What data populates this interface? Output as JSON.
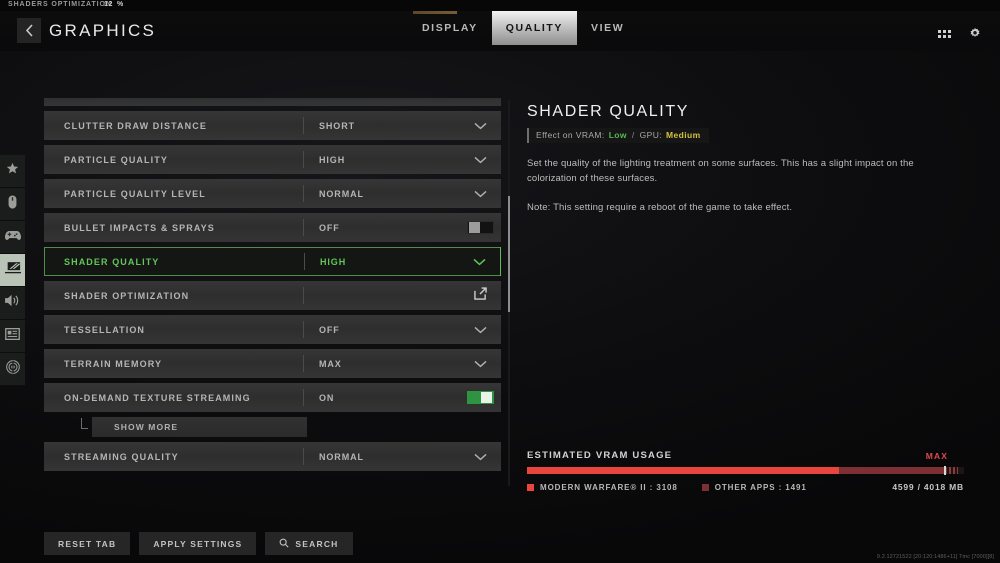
{
  "status_bar": {
    "label": "SHADERS OPTIMIZATION",
    "value": "12",
    "unit": "%"
  },
  "header": {
    "back_icon": "chevron-left-icon",
    "title": "GRAPHICS",
    "tabs": [
      {
        "label": "DISPLAY",
        "active": false
      },
      {
        "label": "QUALITY",
        "active": true
      },
      {
        "label": "VIEW",
        "active": false
      }
    ],
    "icons": [
      {
        "name": "grid-apps-icon"
      },
      {
        "name": "gear-icon"
      }
    ]
  },
  "sidebar": {
    "items": [
      {
        "name": "favorites",
        "icon": "star-icon",
        "active": false
      },
      {
        "name": "mouse-keyboard",
        "icon": "mouse-icon",
        "active": false
      },
      {
        "name": "controller",
        "icon": "gamepad-icon",
        "active": false
      },
      {
        "name": "graphics",
        "icon": "monitor-icon",
        "active": true
      },
      {
        "name": "audio",
        "icon": "speaker-icon",
        "active": false
      },
      {
        "name": "interface",
        "icon": "interface-icon",
        "active": false
      },
      {
        "name": "accessibility",
        "icon": "accessibility-icon",
        "active": false
      }
    ]
  },
  "settings": {
    "rows": [
      {
        "label": "CLUTTER DRAW DISTANCE",
        "value": "SHORT",
        "control": "dropdown",
        "selected": false
      },
      {
        "label": "PARTICLE QUALITY",
        "value": "HIGH",
        "control": "dropdown",
        "selected": false
      },
      {
        "label": "PARTICLE QUALITY LEVEL",
        "value": "NORMAL",
        "control": "dropdown",
        "selected": false
      },
      {
        "label": "BULLET IMPACTS & SPRAYS",
        "value": "OFF",
        "control": "toggle-off",
        "selected": false
      },
      {
        "label": "SHADER QUALITY",
        "value": "HIGH",
        "control": "dropdown",
        "selected": true
      },
      {
        "label": "SHADER OPTIMIZATION",
        "value": "",
        "control": "external-link",
        "selected": false
      },
      {
        "label": "TESSELLATION",
        "value": "OFF",
        "control": "dropdown",
        "selected": false
      },
      {
        "label": "TERRAIN MEMORY",
        "value": "MAX",
        "control": "dropdown",
        "selected": false
      },
      {
        "label": "ON-DEMAND TEXTURE STREAMING",
        "value": "ON",
        "control": "toggle-on",
        "selected": false
      }
    ],
    "show_more_label": "SHOW MORE",
    "last_row": {
      "label": "STREAMING QUALITY",
      "value": "NORMAL",
      "control": "dropdown",
      "selected": false
    }
  },
  "buttons": [
    {
      "label": "RESET TAB",
      "icon": null
    },
    {
      "label": "APPLY SETTINGS",
      "icon": null
    },
    {
      "label": "SEARCH",
      "icon": "search-icon"
    }
  ],
  "detail": {
    "title": "SHADER QUALITY",
    "effect_prefix": "Effect on VRAM:",
    "effect_vram": "Low",
    "effect_separator": "/",
    "effect_gpu_prefix": "GPU:",
    "effect_gpu": "Medium",
    "body": "Set the quality of the lighting treatment on some surfaces. This has a slight impact on the colorization of these surfaces.",
    "note": "Note: This setting require a reboot of the game to take effect."
  },
  "vram": {
    "title": "ESTIMATED VRAM USAGE",
    "max_label": "MAX",
    "legend": [
      {
        "label": "MODERN WARFARE® II : 3108",
        "color": "#e8453f"
      },
      {
        "label": "OTHER APPS : 1491",
        "color": "#7d3033"
      }
    ],
    "total": "4599 / 4018 MB",
    "bar": {
      "game_pct": 71.3,
      "other_pct": 24.9,
      "max_marker_pct": 95.5
    }
  },
  "build_text": "9.2.12721522 [20:120:1486+11] Tmc [7000][8]",
  "colors": {
    "accent_green": "#5fbd57",
    "warn_yellow": "#d3c23d",
    "danger_red": "#e8453f",
    "danger_dark": "#7d3033"
  }
}
